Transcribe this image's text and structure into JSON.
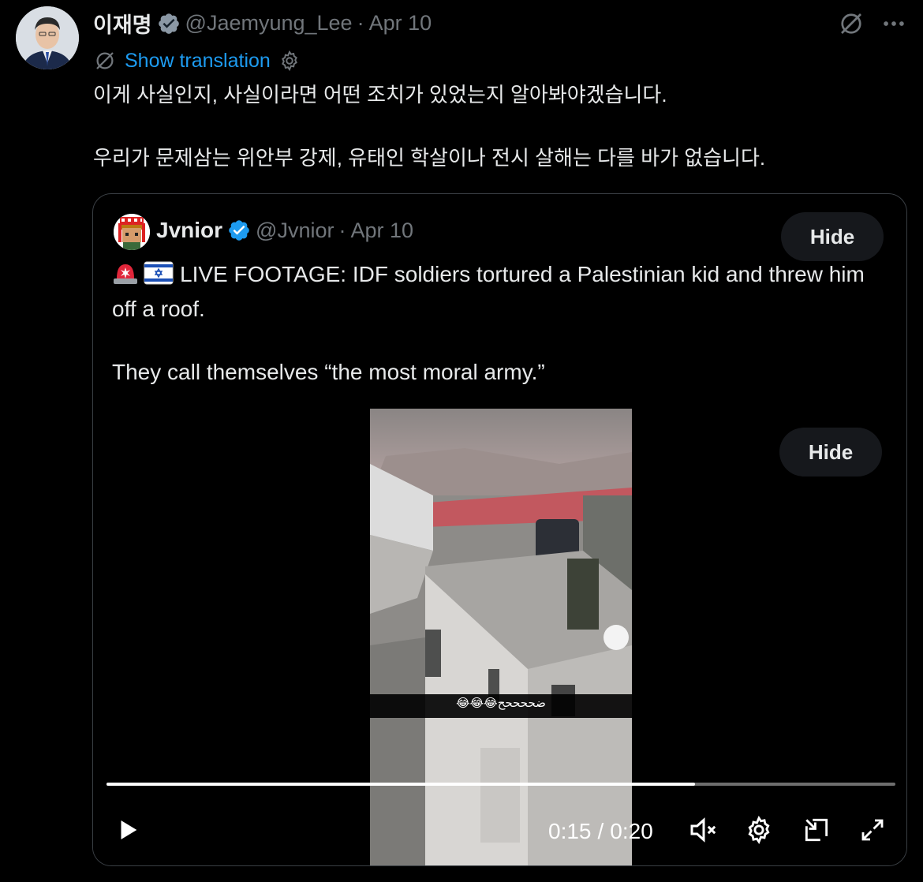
{
  "post": {
    "author_name": "이재명",
    "handle": "@Jaemyung_Lee",
    "separator": "·",
    "date": "Apr 10",
    "show_translation": "Show translation",
    "text_lines": [
      "이게 사실인지, 사실이라면 어떤 조치가 있었는지 알아봐야겠습니다.",
      "우리가 문제삼는 위안부 강제, 유태인 학살이나 전시 살해는 다를 바가 없습니다."
    ],
    "icons": [
      "grok-icon",
      "more-icon",
      "translate-icon",
      "gear-icon",
      "verified-badge-icon"
    ]
  },
  "quote": {
    "author_name": "Jvnior",
    "handle": "@Jvnior",
    "separator": "·",
    "date": "Apr 10",
    "hide_label": "Hide",
    "text_line1_emoji": [
      "rotating-light-emoji",
      "israel-flag-emoji"
    ],
    "text_line1": "LIVE FOOTAGE: IDF soldiers tortured a Palestinian kid and threw him off a roof.",
    "text_line2": "They call themselves “the most moral army.”",
    "video": {
      "hide_label": "Hide",
      "overlay_text": "😂😂😂ضححححح",
      "current_time": "0:15",
      "time_separator": "/",
      "duration": "0:20",
      "progress": 0.746,
      "icons": [
        "play-icon",
        "mute-icon",
        "settings-icon",
        "pip-icon",
        "fullscreen-icon"
      ]
    }
  },
  "colors": {
    "background": "#000000",
    "text": "#e7e9ea",
    "muted": "#71767b",
    "link": "#1d9bf0",
    "border": "#3a3f44",
    "verified": "#1d9bf0"
  }
}
